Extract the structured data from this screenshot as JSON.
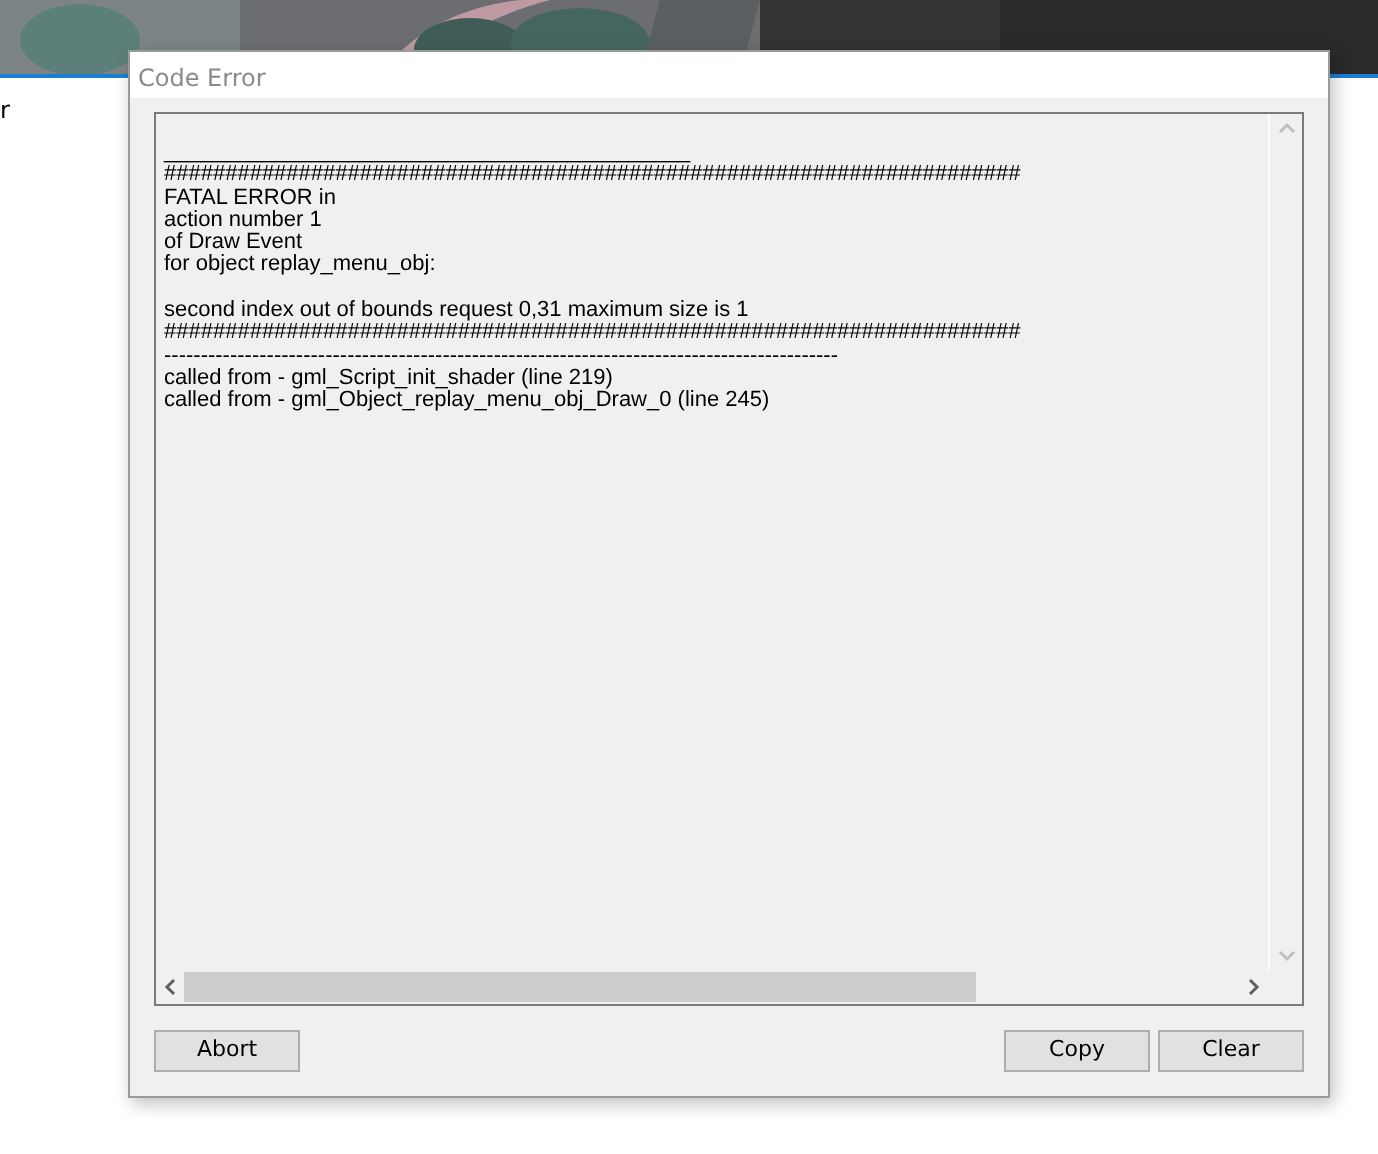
{
  "background": {
    "kind": "picture",
    "side_text": "r"
  },
  "dialog": {
    "title": "Code Error",
    "message_blocks": [
      [
        "___________________________________________",
        "######################################################################",
        "FATAL ERROR in",
        "action number 1",
        "of Draw Event",
        "for object replay_menu_obj:"
      ],
      [
        "second index out of bounds request 0,31 maximum size is 1",
        "######################################################################",
        "--------------------------------------------------------------------------------------------",
        "called from - gml_Script_init_shader (line 219)",
        "called from - gml_Object_replay_menu_obj_Draw_0 (line 245)"
      ]
    ],
    "left_buttons": [
      "Abort"
    ],
    "right_buttons": [
      "Copy",
      "Clear"
    ]
  }
}
